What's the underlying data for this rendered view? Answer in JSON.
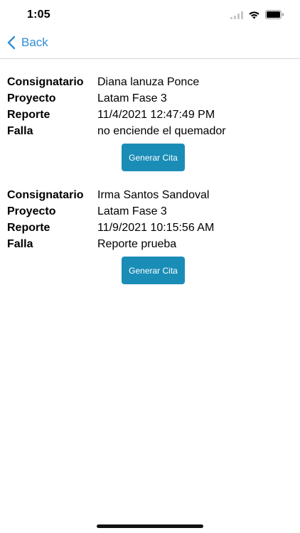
{
  "status_bar": {
    "time": "1:05",
    "icons": [
      "signal-icon",
      "wifi-icon",
      "battery-icon"
    ]
  },
  "nav": {
    "back_label": "Back",
    "accent_color": "#2f8fd6"
  },
  "labels": {
    "consignatario": "Consignatario",
    "proyecto": "Proyecto",
    "reporte": "Reporte",
    "falla": "Falla"
  },
  "reports": [
    {
      "consignatario": "Diana lanuza Ponce",
      "proyecto": "Latam Fase 3",
      "reporte": "11/4/2021 12:47:49 PM",
      "falla": "no enciende el quemador",
      "button_label": "Generar Cita"
    },
    {
      "consignatario": "Irma Santos Sandoval",
      "proyecto": "Latam Fase 3",
      "reporte": "11/9/2021 10:15:56 AM",
      "falla": "Reporte prueba",
      "button_label": "Generar Cita"
    }
  ],
  "colors": {
    "button_bg": "#1a8db7",
    "button_text": "#ffffff"
  }
}
